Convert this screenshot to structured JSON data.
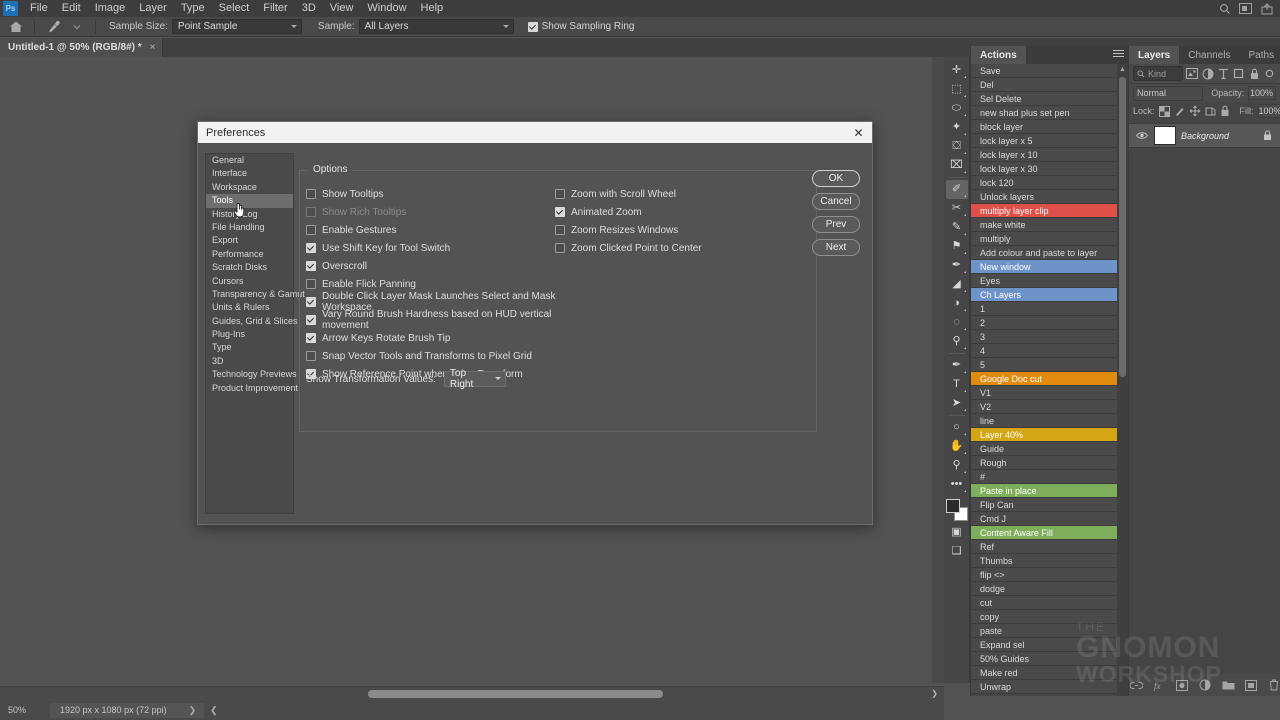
{
  "app": {
    "logo": "ps-logo",
    "menus": [
      "File",
      "Edit",
      "Image",
      "Layer",
      "Type",
      "Select",
      "Filter",
      "3D",
      "View",
      "Window",
      "Help"
    ],
    "window_icons": [
      "search-icon",
      "workspace-icon",
      "share-icon"
    ]
  },
  "options_bar": {
    "home_icon": "home-icon",
    "tool_icon": "eyedropper-icon",
    "tool_caret": "chevron-down-icon",
    "sample_size_label": "Sample Size:",
    "sample_size_value": "Point Sample",
    "sample_label": "Sample:",
    "sample_value": "All Layers",
    "show_sampling_ring_label": "Show Sampling Ring",
    "show_sampling_ring_checked": true
  },
  "document_tab": {
    "title": "Untitled-1 @ 50% (RGB/8#) *",
    "close": "×"
  },
  "toolbar": {
    "tools": [
      {
        "name": "move-tool",
        "glyph": "✛"
      },
      {
        "name": "rectangular-marquee-tool",
        "glyph": "⬚"
      },
      {
        "name": "lasso-tool",
        "glyph": "⬭"
      },
      {
        "name": "quick-selection-tool",
        "glyph": "✦"
      },
      {
        "name": "crop-tool",
        "glyph": "⛋"
      },
      {
        "name": "frame-tool",
        "glyph": "⌧"
      },
      {
        "name": "eyedropper-tool",
        "glyph": "✐",
        "active": true
      },
      {
        "name": "healing-brush-tool",
        "glyph": "✂"
      },
      {
        "name": "brush-tool",
        "glyph": "✎"
      },
      {
        "name": "clone-stamp-tool",
        "glyph": "⚑"
      },
      {
        "name": "history-brush-tool",
        "glyph": "✒"
      },
      {
        "name": "eraser-tool",
        "glyph": "◢"
      },
      {
        "name": "gradient-tool",
        "glyph": "◑"
      },
      {
        "name": "blur-tool",
        "glyph": "◌"
      },
      {
        "name": "dodge-tool",
        "glyph": "⚲"
      },
      {
        "name": "pen-tool",
        "glyph": "✒"
      },
      {
        "name": "type-tool",
        "glyph": "T"
      },
      {
        "name": "path-selection-tool",
        "glyph": "➤"
      },
      {
        "name": "ellipse-tool",
        "glyph": "○"
      },
      {
        "name": "hand-tool",
        "glyph": "✋"
      },
      {
        "name": "zoom-tool",
        "glyph": "⚲"
      },
      {
        "name": "edit-toolbar-tool",
        "glyph": "•••"
      }
    ],
    "swap_colors_icon": "swap-colors-icon",
    "default_colors_icon": "default-colors-icon",
    "foreground_color": "#2b2b2b",
    "background_color": "#ffffff",
    "quick_mask_icon": "quick-mask-icon",
    "screen_mode_icon": "screen-mode-icon"
  },
  "actions_panel": {
    "tab_label": "Actions",
    "menu_icon": "panel-menu-icon",
    "scroll_up_icon": "chevron-up-icon",
    "scroll_down_icon": "chevron-down-icon",
    "items": [
      {
        "label": "Save",
        "color": null
      },
      {
        "label": "Del",
        "color": null
      },
      {
        "label": "Sel Delete",
        "color": null
      },
      {
        "label": "new shad plus set pen",
        "color": null
      },
      {
        "label": "block layer",
        "color": null
      },
      {
        "label": "lock layer x 5",
        "color": null
      },
      {
        "label": "lock layer x 10",
        "color": null
      },
      {
        "label": "lock layer x 30",
        "color": null
      },
      {
        "label": "lock 120",
        "color": null
      },
      {
        "label": "Unlock layers",
        "color": null
      },
      {
        "label": "multiply layer clip",
        "color": "#e0504a"
      },
      {
        "label": "make white",
        "color": null
      },
      {
        "label": "multiply",
        "color": null
      },
      {
        "label": "Add colour and paste to layer",
        "color": null
      },
      {
        "label": "New window",
        "color": "#6e93c8"
      },
      {
        "label": "Eyes",
        "color": null
      },
      {
        "label": "Ch Layers",
        "color": "#6e93c8"
      },
      {
        "label": "1",
        "color": null
      },
      {
        "label": "2",
        "color": null
      },
      {
        "label": "3",
        "color": null
      },
      {
        "label": "4",
        "color": null
      },
      {
        "label": "5",
        "color": null
      },
      {
        "label": "Google Doc cut",
        "color": "#e08a10"
      },
      {
        "label": "V1",
        "color": null
      },
      {
        "label": "V2",
        "color": null
      },
      {
        "label": "line",
        "color": null
      },
      {
        "label": "Layer 40%",
        "color": "#d4a514"
      },
      {
        "label": "Guide",
        "color": null
      },
      {
        "label": "Rough",
        "color": null
      },
      {
        "label": "#",
        "color": null
      },
      {
        "label": "Paste in place",
        "color": "#7fae5a"
      },
      {
        "label": "Flip Can",
        "color": null
      },
      {
        "label": "Cmd J",
        "color": null
      },
      {
        "label": "Content Aware Fill",
        "color": "#7fae5a"
      },
      {
        "label": "Ref",
        "color": null
      },
      {
        "label": "Thumbs",
        "color": null
      },
      {
        "label": "flip <>",
        "color": null
      },
      {
        "label": "dodge",
        "color": null
      },
      {
        "label": "cut",
        "color": null
      },
      {
        "label": "copy",
        "color": null
      },
      {
        "label": "paste",
        "color": null
      },
      {
        "label": "Expand sel",
        "color": null
      },
      {
        "label": "50% Guides",
        "color": null
      },
      {
        "label": "Make red",
        "color": null
      },
      {
        "label": "Unwrap",
        "color": null
      }
    ]
  },
  "layers_panel": {
    "tabs": [
      "Layers",
      "Channels",
      "Paths"
    ],
    "active_tab": "Layers",
    "search_icon": "search-icon",
    "search_placeholder": "Kind",
    "filter_icons": [
      "image-filter-icon",
      "adjustment-filter-icon",
      "type-filter-icon",
      "shape-filter-icon",
      "smart-object-filter-icon",
      "filter-toggle-icon"
    ],
    "blend_mode": "Normal",
    "opacity_label": "Opacity:",
    "opacity_value": "100%",
    "lock_label": "Lock:",
    "lock_icons": [
      "lock-transparency-icon",
      "lock-image-icon",
      "lock-position-icon",
      "lock-artboard-icon",
      "lock-all-icon"
    ],
    "fill_label": "Fill:",
    "fill_value": "100%",
    "layers": [
      {
        "visibility_icon": "eye-icon",
        "name": "Background",
        "locked_icon": "lock-icon"
      }
    ],
    "bottom_icons": [
      "link-layers-icon",
      "layer-style-icon",
      "layer-mask-icon",
      "adjustment-layer-icon",
      "new-group-icon",
      "new-layer-icon",
      "delete-layer-icon"
    ]
  },
  "status_bar": {
    "zoom": "50%",
    "doc_info": "1920 px x 1080 px (72 ppi)",
    "expand_icon": "chevron-right-icon",
    "collapse_icon": "chevron-left-icon"
  },
  "preferences_dialog": {
    "title": "Preferences",
    "close_icon": "close-icon",
    "sidebar": [
      {
        "label": "General",
        "active": false
      },
      {
        "label": "Interface",
        "active": false
      },
      {
        "label": "Workspace",
        "active": false
      },
      {
        "label": "Tools",
        "active": true
      },
      {
        "label": "History Log",
        "active": false
      },
      {
        "label": "File Handling",
        "active": false
      },
      {
        "label": "Export",
        "active": false
      },
      {
        "label": "Performance",
        "active": false
      },
      {
        "label": "Scratch Disks",
        "active": false
      },
      {
        "label": "Cursors",
        "active": false
      },
      {
        "label": "Transparency & Gamut",
        "active": false
      },
      {
        "label": "Units & Rulers",
        "active": false
      },
      {
        "label": "Guides, Grid & Slices",
        "active": false
      },
      {
        "label": "Plug-Ins",
        "active": false
      },
      {
        "label": "Type",
        "active": false
      },
      {
        "label": "3D",
        "active": false
      },
      {
        "label": "Technology Previews",
        "active": false
      },
      {
        "label": "Product Improvement",
        "active": false
      }
    ],
    "group_title": "Options",
    "options_left": [
      {
        "label": "Show Tooltips",
        "checked": false,
        "disabled": false
      },
      {
        "label": "Show Rich Tooltips",
        "checked": false,
        "disabled": true
      },
      {
        "label": "Enable Gestures",
        "checked": false,
        "disabled": false
      },
      {
        "label": "Use Shift Key for Tool Switch",
        "checked": true,
        "disabled": false
      },
      {
        "label": "Overscroll",
        "checked": true,
        "disabled": false
      },
      {
        "label": "Enable Flick Panning",
        "checked": false,
        "disabled": false
      },
      {
        "label": "Double Click Layer Mask Launches Select and Mask Workspace",
        "checked": true,
        "disabled": false
      },
      {
        "label": "Vary Round Brush Hardness based on HUD vertical movement",
        "checked": true,
        "disabled": false
      },
      {
        "label": "Arrow Keys Rotate Brush Tip",
        "checked": true,
        "disabled": false
      },
      {
        "label": "Snap Vector Tools and Transforms to Pixel Grid",
        "checked": false,
        "disabled": false
      },
      {
        "label": "Show Reference Point when using Transform",
        "checked": true,
        "disabled": false
      }
    ],
    "options_right": [
      {
        "label": "Zoom with Scroll Wheel",
        "checked": false,
        "disabled": false
      },
      {
        "label": "Animated Zoom",
        "checked": true,
        "disabled": false
      },
      {
        "label": "Zoom Resizes Windows",
        "checked": false,
        "disabled": false
      },
      {
        "label": "Zoom Clicked Point to Center",
        "checked": false,
        "disabled": false
      }
    ],
    "transform_values_label": "Show Transformation Values:",
    "transform_values_value": "Top Right",
    "buttons": [
      {
        "label": "OK",
        "primary": true
      },
      {
        "label": "Cancel",
        "primary": false
      },
      {
        "label": "Prev",
        "primary": false
      },
      {
        "label": "Next",
        "primary": false
      }
    ]
  },
  "watermark": {
    "line1": "THE",
    "line2": "GNOMON",
    "line3": "WORKSHOP"
  }
}
